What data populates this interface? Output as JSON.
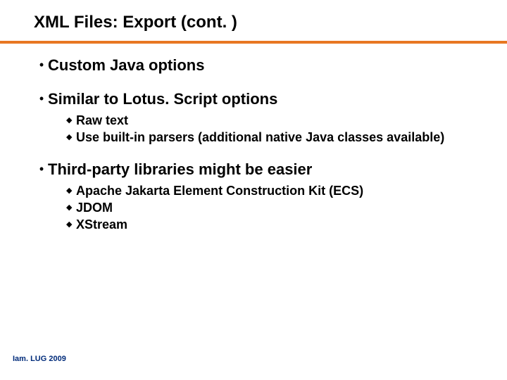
{
  "title": "XML Files: Export (cont. )",
  "bullets": [
    {
      "text": "Custom Java options",
      "sub": []
    },
    {
      "text": "Similar to Lotus. Script options",
      "sub": [
        "Raw text",
        "Use built-in parsers (additional native Java classes available)"
      ]
    },
    {
      "text": "Third-party libraries might be easier",
      "sub": [
        "Apache Jakarta Element Construction Kit (ECS)",
        "JDOM",
        "XStream"
      ]
    }
  ],
  "footer": "Iam. LUG 2009"
}
